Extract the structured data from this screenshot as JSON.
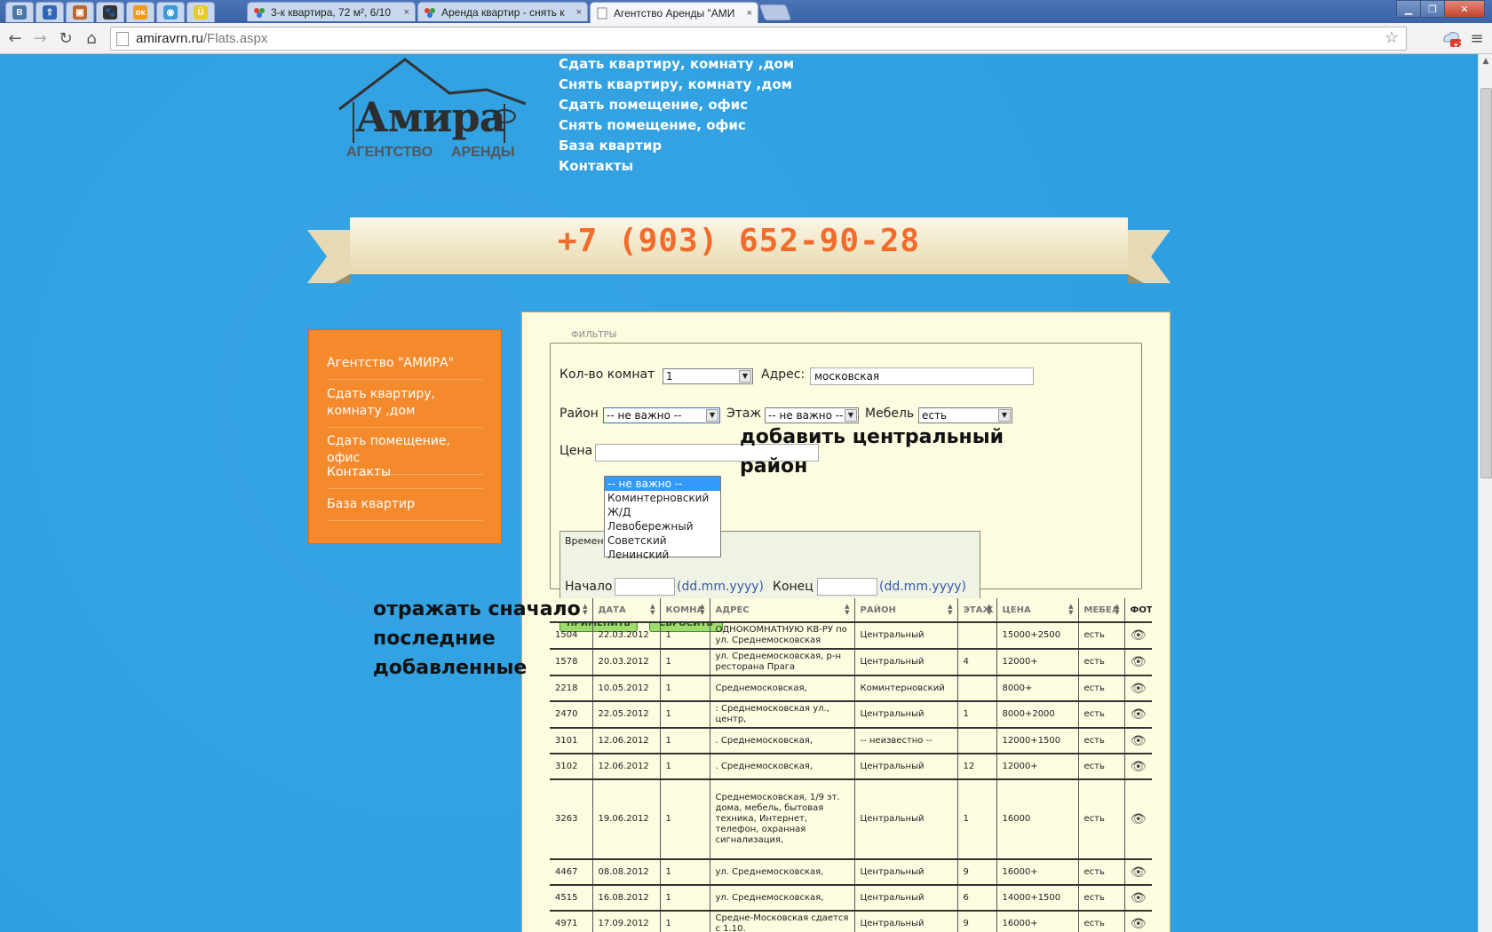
{
  "browser": {
    "pinned_tabs": [
      {
        "icon": "vk-icon",
        "glyph": "В",
        "color": "#4a76a8"
      },
      {
        "icon": "arrow-up-icon",
        "glyph": "⇧",
        "color": "#2f66b5"
      },
      {
        "icon": "photo-icon",
        "glyph": "▣",
        "color": "#c0662a"
      },
      {
        "icon": "paw-icon",
        "glyph": "🐾",
        "color": "#333333"
      },
      {
        "icon": "odnoklassniki-icon",
        "glyph": "ок",
        "color": "#f29a1f"
      },
      {
        "icon": "circle-app-icon",
        "glyph": "◉",
        "color": "#3b9bd8"
      },
      {
        "icon": "yellow-app-icon",
        "glyph": "Ü",
        "color": "#e6c92e"
      }
    ],
    "tabs": [
      {
        "title": "3-к квартира, 72 м², 6/10",
        "close": "×"
      },
      {
        "title": "Аренда квартир - снять к",
        "close": "×"
      },
      {
        "title": "Агентство Аренды \"АМИ",
        "close": "×"
      }
    ],
    "url_host": "amiravrn.ru",
    "url_path": "/Flats.aspx",
    "ext_badge": "+2"
  },
  "site": {
    "logo_name": "Амира",
    "logo_sub_left": "АГЕНТСТВО",
    "logo_sub_right": "АРЕНДЫ",
    "top_links": [
      "Сдать квартиру, комнату ,дом",
      "Снять квартиру, комнату ,дом",
      "Сдать помещение, офис",
      "Снять помещение, офис",
      "База квартир",
      "Контакты"
    ],
    "phone": "+7 (903) 652-90-28",
    "left_menu": [
      "Агентство \"АМИРА\"",
      "Сдать квартиру, комнату ,дом",
      "Сдать помещение, офис",
      "Контакты",
      "База квартир"
    ]
  },
  "filters": {
    "legend": "ФИЛЬТРЫ",
    "rooms_label": "Кол-во комнат",
    "rooms_value": "1",
    "address_label": "Адрес:",
    "address_value": "московская",
    "district_label": "Район",
    "district_value": "-- не важно --",
    "district_options": [
      "-- не важно --",
      "Коминтерновский",
      "Ж/Д",
      "Левобережный",
      "Советский",
      "Ленинский"
    ],
    "floor_label": "Этаж",
    "floor_value": "-- не важно --",
    "furniture_label": "Мебель",
    "furniture_value": "есть",
    "price_label": "Цена",
    "period_label": "Времен",
    "start_label": "Начало",
    "end_label": "Конец",
    "date_hint": "(dd.mm.yyyy)",
    "apply_label": "ПРИМЕНИТЬ",
    "reset_label": "СБРОСИТЬ"
  },
  "table": {
    "headers": [
      "#",
      "ДАТА",
      "КОМНА",
      "АДРЕС",
      "РАЙОН",
      "ЭТАЖ",
      "ЦЕНА",
      "МЕБЕЛ",
      "ФОТ"
    ],
    "rows": [
      [
        "1504",
        "22.03.2012",
        "1",
        "ОДНОКОМНАТНУЮ КВ-РУ по ул. Среднемосковская",
        "Центральный",
        "",
        "15000+2500",
        "есть"
      ],
      [
        "1578",
        "20.03.2012",
        "1",
        "ул. Среднемосковская, р-н ресторана Прага",
        "Центральный",
        "4",
        "12000+",
        "есть"
      ],
      [
        "2218",
        "10.05.2012",
        "1",
        "Среднемосковская,",
        "Коминтерновский",
        "",
        "8000+",
        "есть"
      ],
      [
        "2470",
        "22.05.2012",
        "1",
        ": Среднемосковская ул., центр,",
        "Центральный",
        "1",
        "8000+2000",
        "есть"
      ],
      [
        "3101",
        "12.06.2012",
        "1",
        ". Среднемосковская,",
        "-- неизвестно --",
        "",
        "12000+1500",
        "есть"
      ],
      [
        "3102",
        "12.06.2012",
        "1",
        ". Среднемосковская,",
        "Центральный",
        "12",
        "12000+",
        "есть"
      ],
      [
        "3263",
        "19.06.2012",
        "1",
        "Среднемосковская, 1/9 эт. дома, мебель, бытовая техника, Интернет, телефон, охранная сигнализация,",
        "Центральный",
        "1",
        "16000",
        "есть"
      ],
      [
        "4467",
        "08.08.2012",
        "1",
        "ул. Среднемосковская,",
        "Центральный",
        "9",
        "16000+",
        "есть"
      ],
      [
        "4515",
        "16.08.2012",
        "1",
        "ул. Среднемосковская,",
        "Центральный",
        "6",
        "14000+1500",
        "есть"
      ],
      [
        "4971",
        "17.09.2012",
        "1",
        "Средне-Московская сдается с 1.10.",
        "Центральный",
        "9",
        "16000+",
        "есть"
      ]
    ],
    "photo_icon": "👁"
  },
  "annotations": {
    "district_note_1": "добавить центральный",
    "district_note_2": "район",
    "order_note_1": "отражать сначало",
    "order_note_2": "последние",
    "order_note_3": "добавленные"
  }
}
